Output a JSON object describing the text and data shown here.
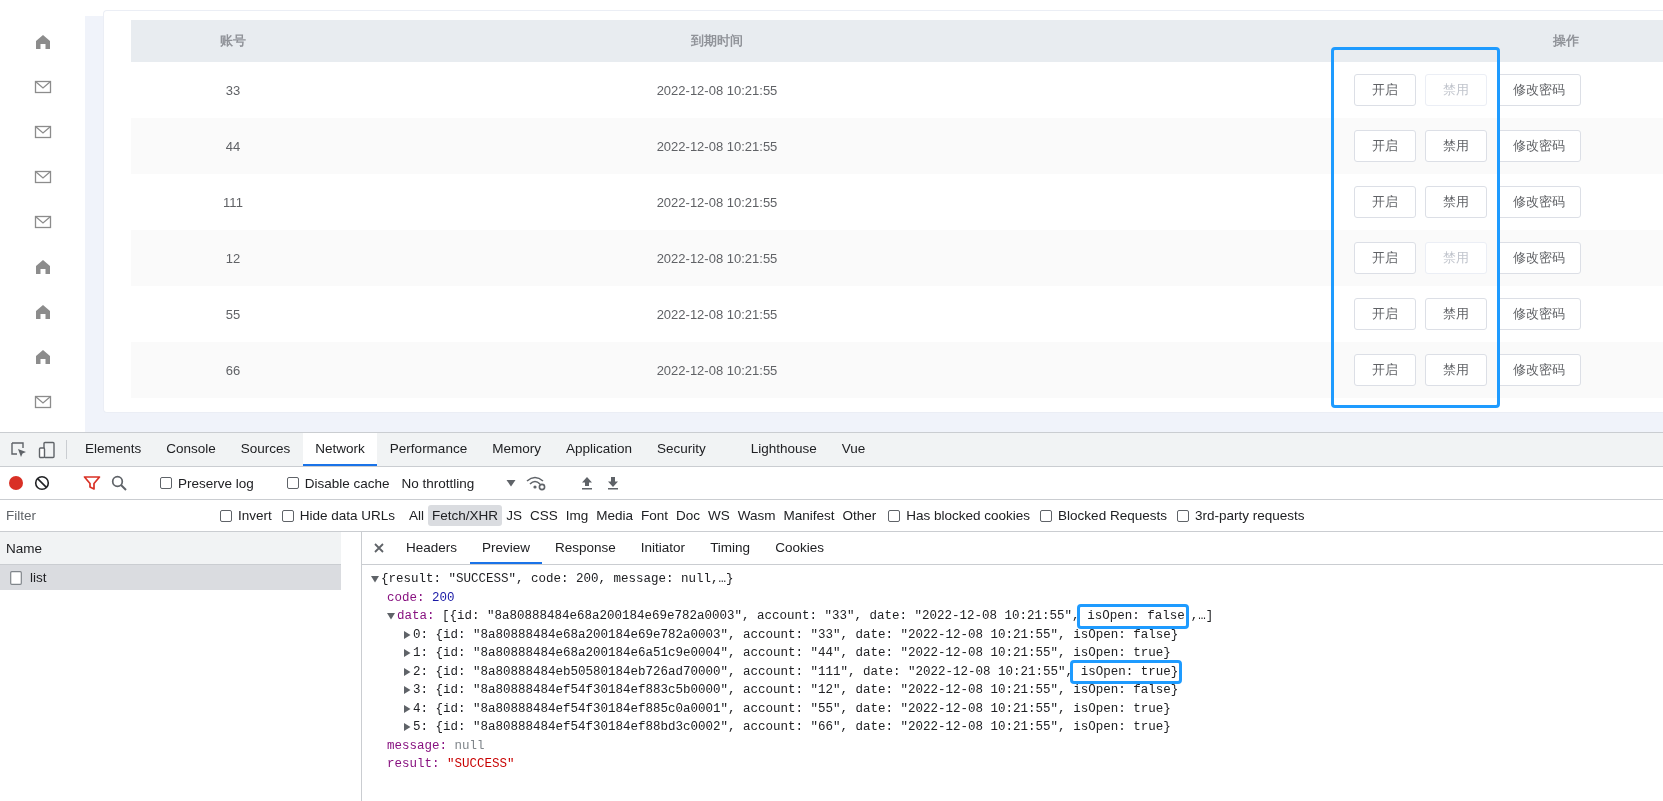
{
  "sidebar": {
    "items": [
      {
        "kind": "home"
      },
      {
        "kind": "mail"
      },
      {
        "kind": "mail"
      },
      {
        "kind": "mail"
      },
      {
        "kind": "mail"
      },
      {
        "kind": "home"
      },
      {
        "kind": "home"
      },
      {
        "kind": "home"
      },
      {
        "kind": "mail"
      }
    ]
  },
  "table": {
    "columns": [
      "账号",
      "到期时间",
      "操作"
    ],
    "actions_highlighted": true,
    "rows": [
      {
        "account": "33",
        "date": "2022-12-08 10:21:55",
        "actions": [
          {
            "label": "开启",
            "disabled": false
          },
          {
            "label": "禁用",
            "disabled": true
          },
          {
            "label": "修改密码",
            "disabled": false
          }
        ]
      },
      {
        "account": "44",
        "date": "2022-12-08 10:21:55",
        "actions": [
          {
            "label": "开启",
            "disabled": false
          },
          {
            "label": "禁用",
            "disabled": false
          },
          {
            "label": "修改密码",
            "disabled": false
          }
        ]
      },
      {
        "account": "111",
        "date": "2022-12-08 10:21:55",
        "actions": [
          {
            "label": "开启",
            "disabled": false
          },
          {
            "label": "禁用",
            "disabled": false
          },
          {
            "label": "修改密码",
            "disabled": false
          }
        ]
      },
      {
        "account": "12",
        "date": "2022-12-08 10:21:55",
        "actions": [
          {
            "label": "开启",
            "disabled": false
          },
          {
            "label": "禁用",
            "disabled": true
          },
          {
            "label": "修改密码",
            "disabled": false
          }
        ]
      },
      {
        "account": "55",
        "date": "2022-12-08 10:21:55",
        "actions": [
          {
            "label": "开启",
            "disabled": false
          },
          {
            "label": "禁用",
            "disabled": false
          },
          {
            "label": "修改密码",
            "disabled": false
          }
        ]
      },
      {
        "account": "66",
        "date": "2022-12-08 10:21:55",
        "actions": [
          {
            "label": "开启",
            "disabled": false
          },
          {
            "label": "禁用",
            "disabled": false
          },
          {
            "label": "修改密码",
            "disabled": false
          }
        ]
      }
    ]
  },
  "devtools": {
    "tabs": [
      {
        "label": "Elements",
        "selected": false
      },
      {
        "label": "Console",
        "selected": false
      },
      {
        "label": "Sources",
        "selected": false
      },
      {
        "label": "Network",
        "selected": true
      },
      {
        "label": "Performance",
        "selected": false
      },
      {
        "label": "Memory",
        "selected": false
      },
      {
        "label": "Application",
        "selected": false
      },
      {
        "label": "Security",
        "selected": false
      },
      {
        "label": "Lighthouse",
        "selected": false
      },
      {
        "label": "Vue",
        "selected": false
      }
    ],
    "toolbar": {
      "recording": true,
      "filter_active": true,
      "preserve_log": {
        "label": "Preserve log",
        "checked": false
      },
      "disable_cache": {
        "label": "Disable cache",
        "checked": false
      },
      "throttling": "No throttling"
    },
    "filter": {
      "placeholder": "Filter",
      "options": [
        {
          "label": "Invert",
          "checked": false
        },
        {
          "label": "Hide data URLs",
          "checked": false
        }
      ],
      "types": [
        {
          "label": "All",
          "selected": false
        },
        {
          "label": "Fetch/XHR",
          "selected": true
        },
        {
          "label": "JS",
          "selected": false
        },
        {
          "label": "CSS",
          "selected": false
        },
        {
          "label": "Img",
          "selected": false
        },
        {
          "label": "Media",
          "selected": false
        },
        {
          "label": "Font",
          "selected": false
        },
        {
          "label": "Doc",
          "selected": false
        },
        {
          "label": "WS",
          "selected": false
        },
        {
          "label": "Wasm",
          "selected": false
        },
        {
          "label": "Manifest",
          "selected": false
        },
        {
          "label": "Other",
          "selected": false
        }
      ],
      "more_options": [
        {
          "label": "Has blocked cookies",
          "checked": false
        },
        {
          "label": "Blocked Requests",
          "checked": false
        },
        {
          "label": "3rd-party requests",
          "checked": false
        }
      ]
    },
    "requests": {
      "column": "Name",
      "items": [
        {
          "name": "list",
          "selected": true
        }
      ]
    },
    "detail_tabs": [
      {
        "label": "Headers",
        "selected": false
      },
      {
        "label": "Preview",
        "selected": true
      },
      {
        "label": "Response",
        "selected": false
      },
      {
        "label": "Initiator",
        "selected": false
      },
      {
        "label": "Timing",
        "selected": false
      },
      {
        "label": "Cookies",
        "selected": false
      }
    ],
    "preview": {
      "expanded": true,
      "parts": [
        {
          "text": "{result: \"SUCCESS\", code: 200, message: null,…}",
          "highlighted": false
        }
      ],
      "children": [
        {
          "key": "code:",
          "value": "200",
          "kind": "number"
        },
        {
          "key": "data:",
          "expanded": true,
          "parts": [
            {
              "text": "[{id: \"8a80888484e68a200184e69e782a0003\", account: \"33\", date: \"2022-12-08 10:21:55\",",
              "highlighted": false
            },
            {
              "text": " isOpen: false",
              "highlighted": true
            },
            {
              "text": ",…]",
              "highlighted": false
            }
          ],
          "children": [
            {
              "key": "0:",
              "expanded": false,
              "parts": [
                {
                  "text": "{id: \"8a80888484e68a200184e69e782a0003\", account: \"33\", date: \"2022-12-08 10:21:55\",",
                  "highlighted": false
                },
                {
                  "text": " isOpen: false}",
                  "highlighted": false
                }
              ]
            },
            {
              "key": "1:",
              "expanded": false,
              "parts": [
                {
                  "text": "{id: \"8a80888484e68a200184e6a51c9e0004\", account: \"44\", date: \"2022-12-08 10:21:55\",",
                  "highlighted": false
                },
                {
                  "text": " isOpen: true}",
                  "highlighted": false
                }
              ]
            },
            {
              "key": "2:",
              "expanded": false,
              "parts": [
                {
                  "text": "{id: \"8a80888484eb50580184eb726ad70000\", account: \"111\", date: \"2022-12-08 10:21:55\",",
                  "highlighted": false
                },
                {
                  "text": " isOpen: true}",
                  "highlighted": true
                }
              ]
            },
            {
              "key": "3:",
              "expanded": false,
              "parts": [
                {
                  "text": "{id: \"8a80888484ef54f30184ef883c5b0000\", account: \"12\", date: \"2022-12-08 10:21:55\",",
                  "highlighted": false
                },
                {
                  "text": " isOpen: false}",
                  "highlighted": false
                }
              ]
            },
            {
              "key": "4:",
              "expanded": false,
              "parts": [
                {
                  "text": "{id: \"8a80888484ef54f30184ef885c0a0001\", account: \"55\", date: \"2022-12-08 10:21:55\",",
                  "highlighted": false
                },
                {
                  "text": " isOpen: true}",
                  "highlighted": false
                }
              ]
            },
            {
              "key": "5:",
              "expanded": false,
              "parts": [
                {
                  "text": "{id: \"8a80888484ef54f30184ef88bd3c0002\", account: \"66\", date: \"2022-12-08 10:21:55\",",
                  "highlighted": false
                },
                {
                  "text": " isOpen: true}",
                  "highlighted": false
                }
              ]
            }
          ]
        },
        {
          "key": "message:",
          "value": "null",
          "kind": "null"
        },
        {
          "key": "result:",
          "value": "\"SUCCESS\"",
          "kind": "string"
        }
      ]
    }
  }
}
